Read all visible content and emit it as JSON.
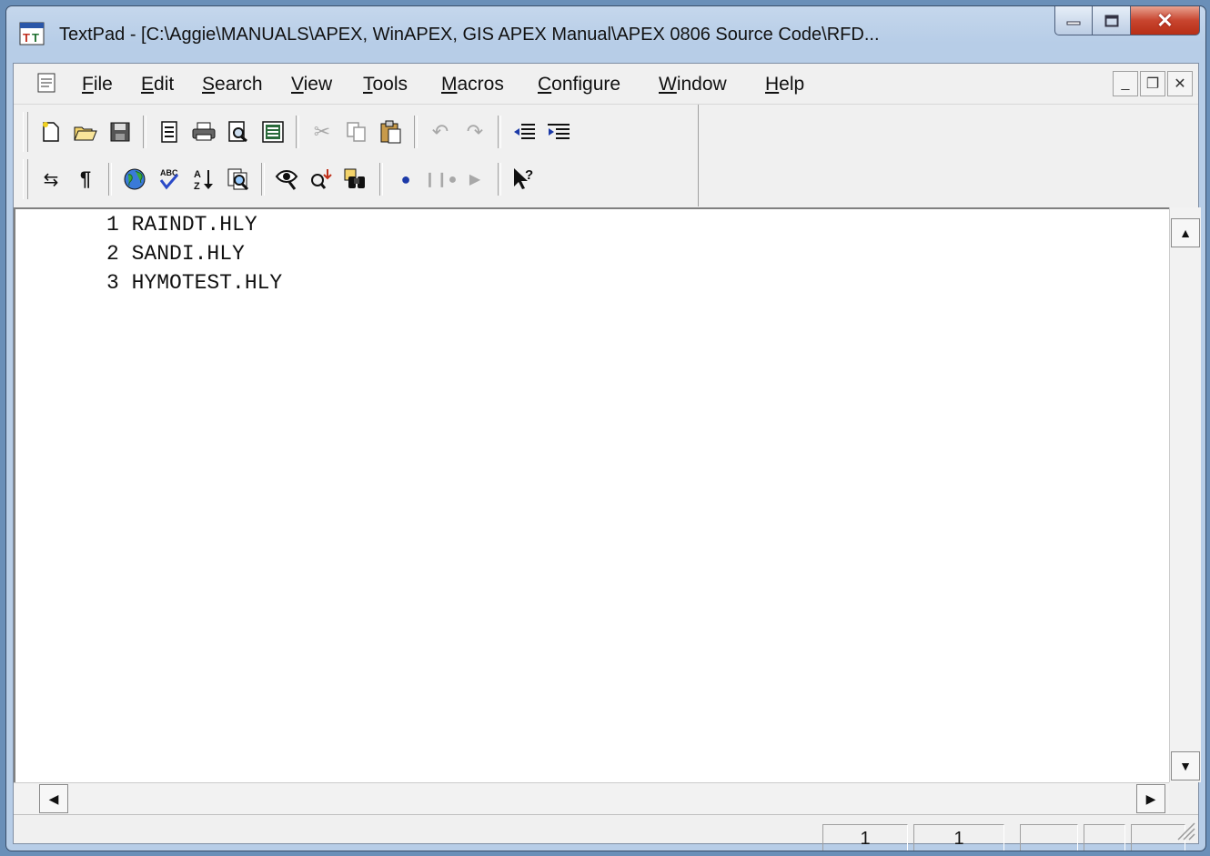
{
  "window": {
    "title": "TextPad - [C:\\Aggie\\MANUALS\\APEX, WinAPEX, GIS APEX Manual\\APEX 0806 Source Code\\RFD..."
  },
  "menu": [
    {
      "label": "File",
      "key": "F",
      "rest": "ile"
    },
    {
      "label": "Edit",
      "key": "E",
      "rest": "dit"
    },
    {
      "label": "Search",
      "key": "S",
      "rest": "earch"
    },
    {
      "label": "View",
      "key": "V",
      "rest": "iew"
    },
    {
      "label": "Tools",
      "key": "T",
      "rest": "ools"
    },
    {
      "label": "Macros",
      "key": "M",
      "rest": "acros"
    },
    {
      "label": "Configure",
      "key": "C",
      "rest": "onfigure"
    },
    {
      "label": "Window",
      "key": "W",
      "rest": "indow"
    },
    {
      "label": "Help",
      "key": "H",
      "rest": "elp"
    }
  ],
  "editor": {
    "lines": [
      "1 RAINDT.HLY",
      "2 SANDI.HLY",
      "3 HYMOTEST.HLY"
    ]
  },
  "status": {
    "line": "1",
    "column": "1"
  },
  "colors": {
    "close_button": "#c8452f",
    "titlebar": "#b7cde7"
  }
}
